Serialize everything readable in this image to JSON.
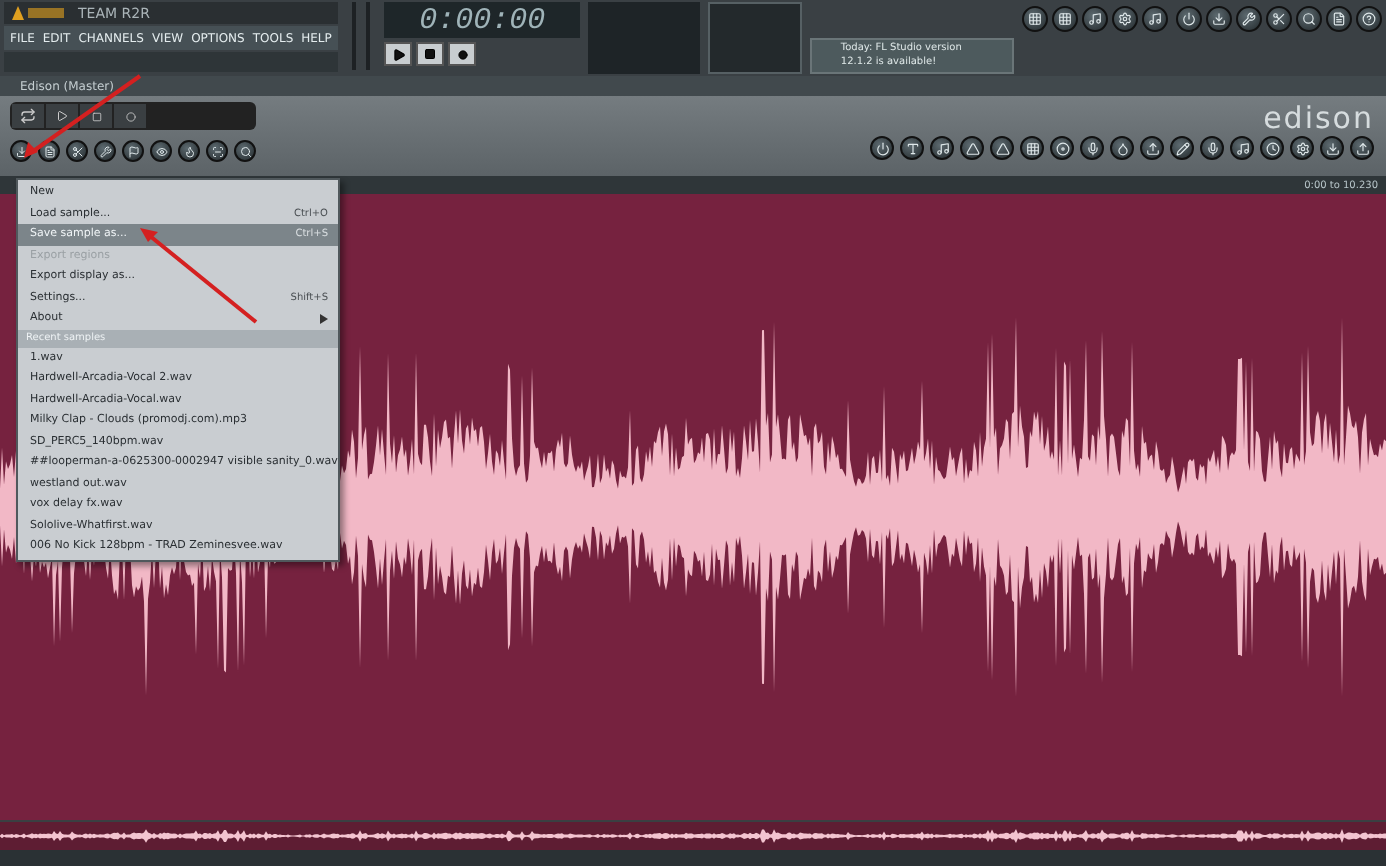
{
  "app_title": "TEAM R2R",
  "menu_bar": [
    "FILE",
    "EDIT",
    "CHANNELS",
    "VIEW",
    "OPTIONS",
    "TOOLS",
    "HELP"
  ],
  "transport": {
    "time": "0:00:00"
  },
  "hint": {
    "lines": [
      "Today: FL Studio version",
      "12.1.2 is available!"
    ]
  },
  "editor": {
    "title": "Edison (Master)",
    "logo": "edison",
    "range": "0:00 to 10.230"
  },
  "file_menu": {
    "items": [
      {
        "kind": "item",
        "label": "New",
        "disabled": false,
        "selected": false
      },
      {
        "kind": "item",
        "label": "Load sample...",
        "shortcut": "Ctrl+O",
        "disabled": false,
        "selected": false
      },
      {
        "kind": "item",
        "label": "Save sample as...",
        "shortcut": "Ctrl+S",
        "disabled": false,
        "selected": true
      },
      {
        "kind": "item",
        "label": "Export regions",
        "disabled": true,
        "selected": false
      },
      {
        "kind": "item",
        "label": "Export display as...",
        "disabled": false,
        "selected": false
      },
      {
        "kind": "item",
        "label": "Settings...",
        "shortcut": "Shift+S",
        "disabled": false,
        "selected": false
      },
      {
        "kind": "submenu",
        "label": "About",
        "disabled": false,
        "selected": false
      },
      {
        "kind": "header",
        "label": "Recent samples"
      },
      {
        "kind": "item",
        "label": "1.wav",
        "disabled": false,
        "selected": false
      },
      {
        "kind": "item",
        "label": "Hardwell-Arcadia-Vocal 2.wav",
        "disabled": false,
        "selected": false
      },
      {
        "kind": "item",
        "label": "Hardwell-Arcadia-Vocal.wav",
        "disabled": false,
        "selected": false
      },
      {
        "kind": "item",
        "label": "Milky Clap - Clouds (promodj.com).mp3",
        "disabled": false,
        "selected": false
      },
      {
        "kind": "item",
        "label": "SD_PERC5_140bpm.wav",
        "disabled": false,
        "selected": false
      },
      {
        "kind": "item",
        "label": "##looperman-a-0625300-0002947 visible sanity_0.wav",
        "disabled": false,
        "selected": false
      },
      {
        "kind": "item",
        "label": "westland out.wav",
        "disabled": false,
        "selected": false
      },
      {
        "kind": "item",
        "label": "vox delay fx.wav",
        "disabled": false,
        "selected": false
      },
      {
        "kind": "item",
        "label": "Sololive-Whatfirst.wav",
        "disabled": false,
        "selected": false
      },
      {
        "kind": "item",
        "label": "006 No Kick 128bpm - TRAD Zeminesvee.wav",
        "disabled": false,
        "selected": false
      }
    ]
  }
}
